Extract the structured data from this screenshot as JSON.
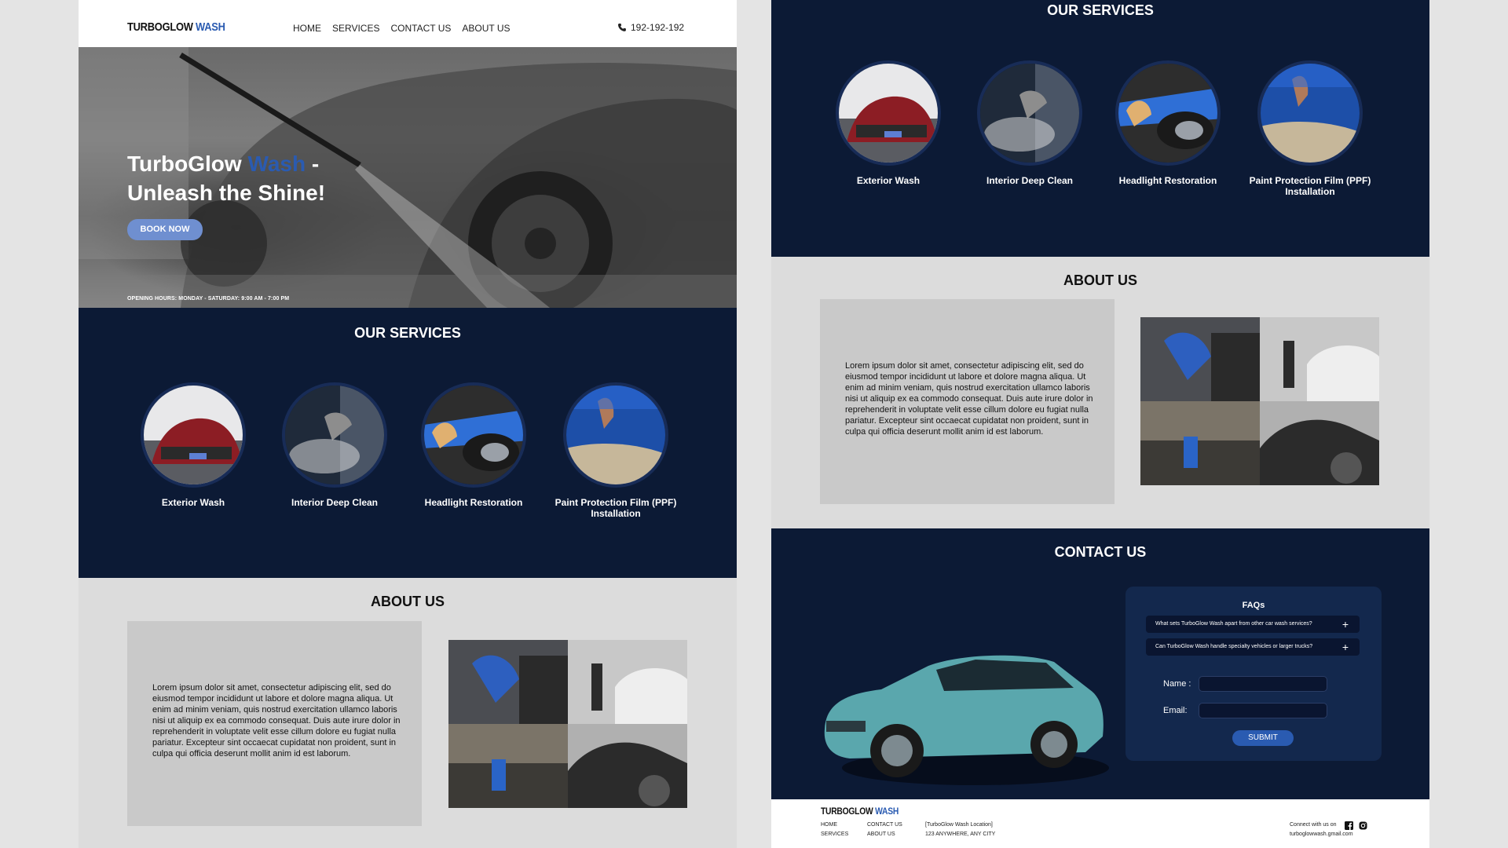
{
  "brand": {
    "name": "TURBOGLOW",
    "accent": "WASH",
    "accent_color": "#2a5bb1",
    "navy": "#0c1a35"
  },
  "nav": {
    "items": [
      "HOME",
      "SERVICES",
      "CONTACT US",
      "ABOUT US"
    ],
    "phone": "192-192-192",
    "phone_icon": "phone-icon"
  },
  "hero": {
    "title_line1_part1": "TurboGlow",
    "title_line1_accent": "Wash",
    "title_line1_part2": " -",
    "title_line2": "Unleash the Shine!",
    "button": "BOOK NOW",
    "hours": "OPENING HOURS: MONDAY - SATURDAY: 9:00 AM - 7:00 PM"
  },
  "services": {
    "title": "OUR SERVICES",
    "items": [
      {
        "label": "Exterior Wash"
      },
      {
        "label": "Interior Deep Clean"
      },
      {
        "label": "Headlight Restoration"
      },
      {
        "label": "Paint Protection Film (PPF) Installation"
      }
    ]
  },
  "about": {
    "title": "ABOUT US",
    "text": "Lorem ipsum dolor sit amet, consectetur adipiscing elit, sed do eiusmod tempor incididunt ut labore et dolore magna aliqua. Ut enim ad minim veniam, quis nostrud exercitation ullamco laboris nisi ut aliquip ex ea commodo consequat. Duis aute irure dolor in reprehenderit in voluptate velit esse cillum dolore eu fugiat nulla pariatur. Excepteur sint occaecat cupidatat non proident, sunt in culpa qui officia deserunt mollit anim id est laborum."
  },
  "contact": {
    "title": "CONTACT US",
    "faq_title": "FAQs",
    "faqs": [
      "What sets TurboGlow Wash apart from other car wash services?",
      "Can TurboGlow Wash handle specialty vehicles or larger trucks?"
    ],
    "name_label": "Name :",
    "email_label": "Email:",
    "submit": "SUBMIT"
  },
  "footer": {
    "nav_col1": [
      "HOME",
      "SERVICES"
    ],
    "nav_col2": [
      "CONTACT US",
      "ABOUT US"
    ],
    "location_line1": "[TurboGlow Wash Location]",
    "location_line2": "123 ANYWHERE, ANY CITY",
    "connect": "Connect with us on",
    "email": "turboglowwash.gmail.com",
    "social_icons": [
      "facebook-icon",
      "instagram-icon"
    ]
  }
}
